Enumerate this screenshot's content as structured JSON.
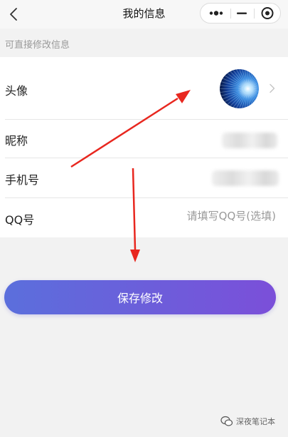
{
  "navbar": {
    "title": "我的信息"
  },
  "section": {
    "hint": "可直接修改信息"
  },
  "profile": {
    "avatar_label": "头像",
    "nickname_label": "昵称",
    "phone_label": "手机号",
    "qq_label": "QQ号",
    "qq_placeholder": "请填写QQ号(选填)",
    "qq_value": ""
  },
  "actions": {
    "save_label": "保存修改"
  },
  "watermark": {
    "text": "深夜笔记本"
  },
  "colors": {
    "button_gradient_start": "#5b6fdc",
    "button_gradient_end": "#7b4fd9",
    "annotation_arrow": "#e8271f",
    "page_background": "#f2f2f2"
  },
  "icons": {
    "back": "chevron-left-icon",
    "more": "more-dots-icon",
    "minimize": "minimize-icon",
    "close": "target-close-icon",
    "row_chevron": "chevron-right-icon"
  }
}
